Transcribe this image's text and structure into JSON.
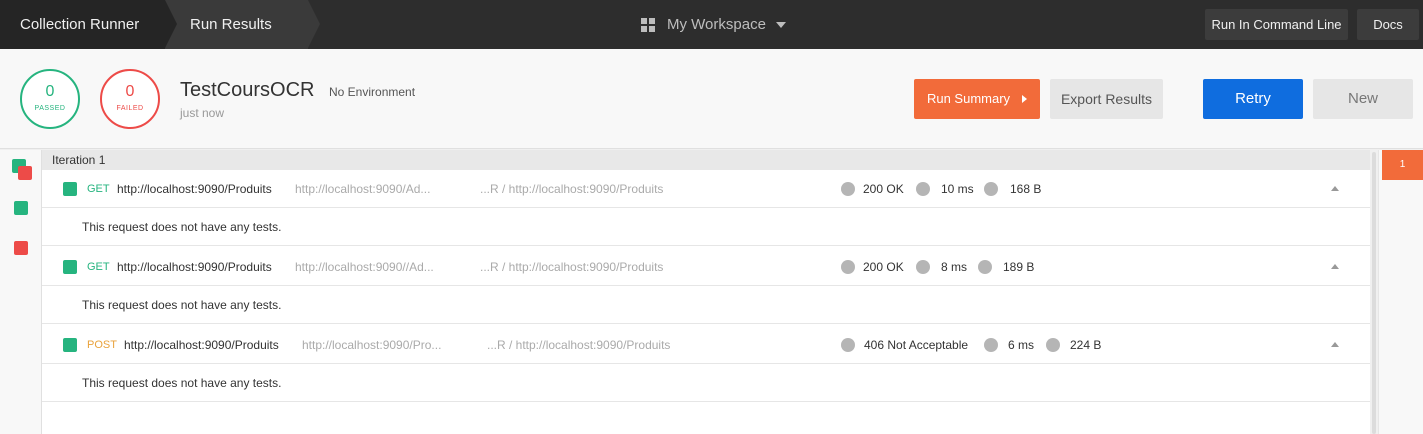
{
  "topbar": {
    "crumb_runner": "Collection Runner",
    "crumb_results": "Run Results",
    "workspace": "My Workspace",
    "run_cmd_label": "Run In Command Line",
    "docs_label": "Docs"
  },
  "summary": {
    "passed_count": "0",
    "passed_label": "PASSED",
    "failed_count": "0",
    "failed_label": "FAILED",
    "collection_name": "TestCoursOCR",
    "environment": "No Environment",
    "time": "just now",
    "run_summary_label": "Run Summary",
    "export_label": "Export Results",
    "retry_label": "Retry",
    "new_label": "New"
  },
  "iteration": {
    "label": "Iteration 1",
    "pill": "1"
  },
  "requests": [
    {
      "method": "GET",
      "url": "http://localhost:9090/Produits",
      "url_short": "http://localhost:9090/Ad...",
      "path": "...R / http://localhost:9090/Produits",
      "status": "200 OK",
      "time": "10 ms",
      "size": "168 B",
      "tests": "This request does not have any tests."
    },
    {
      "method": "GET",
      "url": "http://localhost:9090/Produits",
      "url_short": "http://localhost:9090//Ad...",
      "path": "...R / http://localhost:9090/Produits",
      "status": "200 OK",
      "time": "8 ms",
      "size": "189 B",
      "tests": "This request does not have any tests."
    },
    {
      "method": "POST",
      "url": "http://localhost:9090/Produits",
      "url_short": "http://localhost:9090/Pro...",
      "path": "...R / http://localhost:9090/Produits",
      "status": "406 Not Acceptable",
      "time": "6 ms",
      "size": "224 B",
      "tests": "This request does not have any tests."
    }
  ],
  "colors": {
    "pass": "#26b47f",
    "fail": "#ed4b48",
    "accent": "#f26b3a",
    "primary": "#0f6ddf"
  }
}
